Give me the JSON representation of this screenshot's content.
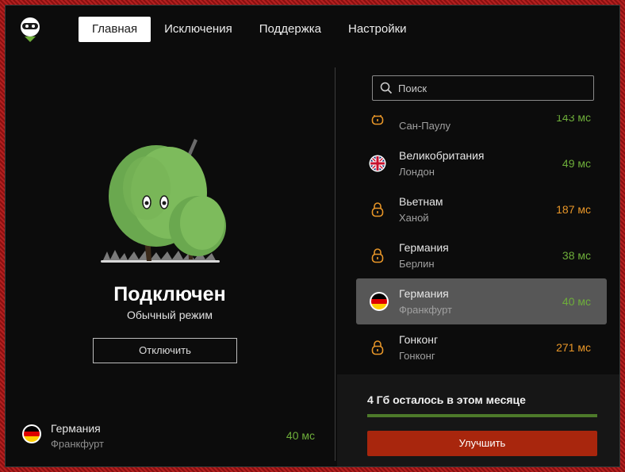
{
  "nav": {
    "tabs": [
      {
        "label": "Главная",
        "active": true
      },
      {
        "label": "Исключения",
        "active": false
      },
      {
        "label": "Поддержка",
        "active": false
      },
      {
        "label": "Настройки",
        "active": false
      }
    ]
  },
  "status": {
    "title": "Подключен",
    "mode": "Обычный режим",
    "disconnect_label": "Отключить"
  },
  "current_location": {
    "country": "Германия",
    "city": "Франкфурт",
    "ping": "40 мс",
    "flag": "germany-flag"
  },
  "search": {
    "placeholder": "Поиск",
    "value": ""
  },
  "servers": [
    {
      "country": "",
      "city": "Сан-Паулу",
      "ping": "143 мс",
      "icon": "lock-icon",
      "ping_level": "good",
      "selected": false
    },
    {
      "country": "Великобритания",
      "city": "Лондон",
      "ping": "49 мс",
      "icon": "uk-flag-icon",
      "ping_level": "good",
      "selected": false
    },
    {
      "country": "Вьетнам",
      "city": "Ханой",
      "ping": "187 мс",
      "icon": "lock-icon",
      "ping_level": "warn",
      "selected": false
    },
    {
      "country": "Германия",
      "city": "Берлин",
      "ping": "38 мс",
      "icon": "lock-icon",
      "ping_level": "good",
      "selected": false
    },
    {
      "country": "Германия",
      "city": "Франкфурт",
      "ping": "40 мс",
      "icon": "germany-flag-icon",
      "ping_level": "good",
      "selected": true
    },
    {
      "country": "Гонконг",
      "city": "Гонконг",
      "ping": "271 мс",
      "icon": "lock-icon",
      "ping_level": "warn",
      "selected": false
    }
  ],
  "quota": {
    "text": "4 Гб осталось в этом месяце",
    "fraction_remaining": 1.0,
    "upgrade_label": "Улучшить"
  },
  "colors": {
    "accent_green": "#6eae3a",
    "accent_orange": "#e89628",
    "upgrade_red": "#a8260d",
    "selected_row": "#575757"
  }
}
